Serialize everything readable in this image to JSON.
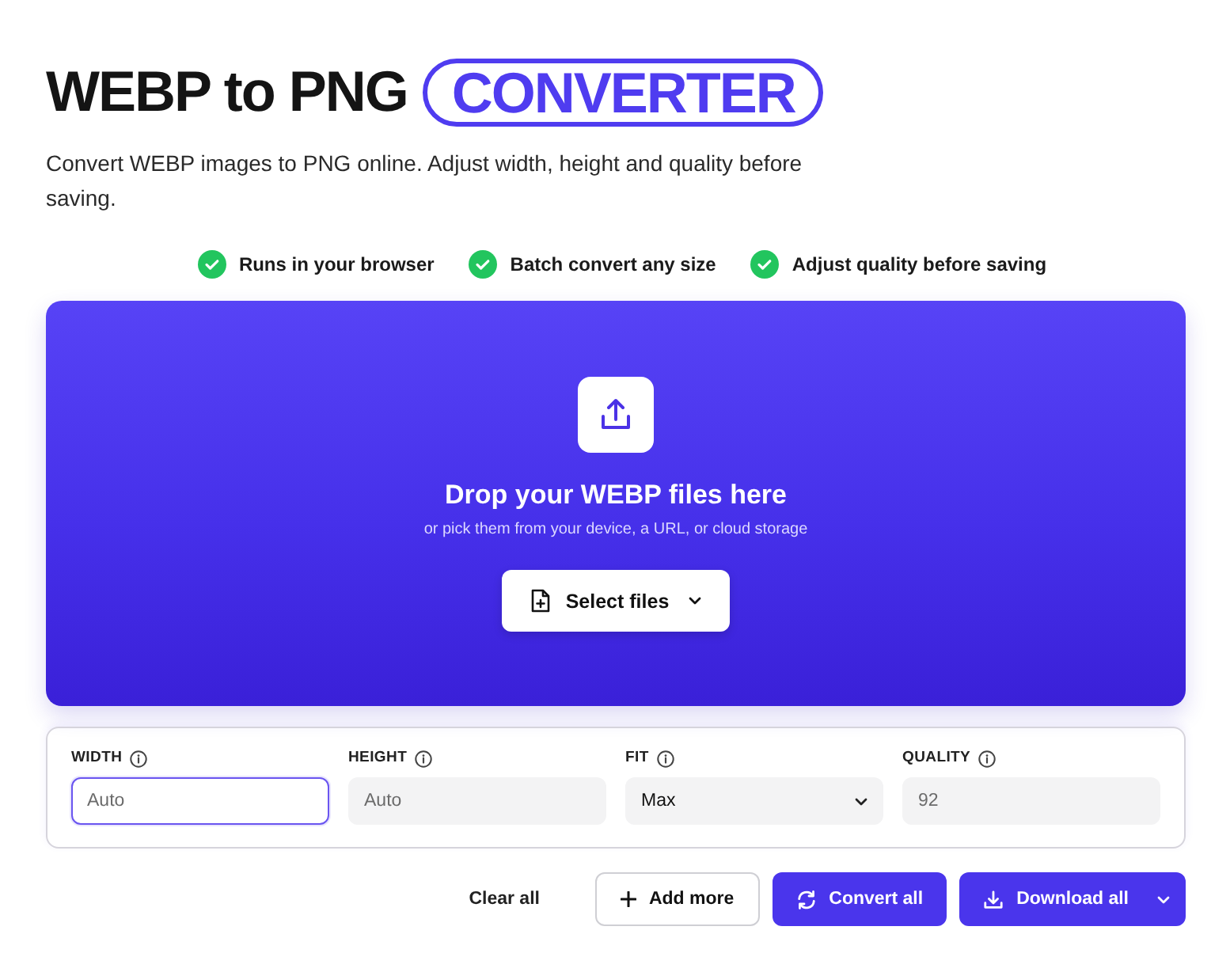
{
  "header": {
    "title": "WEBP to PNG",
    "title_badge": "CONVERTER",
    "description": "Convert WEBP images to PNG online. Adjust width, height and quality before saving."
  },
  "features": [
    {
      "label": "Runs in your browser"
    },
    {
      "label": "Batch convert any size"
    },
    {
      "label": "Adjust quality before saving"
    }
  ],
  "dropzone": {
    "heading": "Drop your WEBP files here",
    "subtext": "or pick them from your device, a URL, or cloud storage",
    "select_button": "Select files"
  },
  "settings": [
    {
      "kind": "input",
      "label": "WIDTH",
      "placeholder": "Auto",
      "focused": true
    },
    {
      "kind": "input",
      "label": "HEIGHT",
      "placeholder": "Auto",
      "focused": false
    },
    {
      "kind": "select",
      "label": "FIT",
      "value": "Max",
      "focused": false
    },
    {
      "kind": "input",
      "label": "QUALITY",
      "placeholder": "92",
      "focused": false
    }
  ],
  "actions": [
    {
      "kind": "text",
      "label": "Clear all"
    },
    {
      "kind": "outline",
      "label": "Add more"
    },
    {
      "kind": "primary",
      "label": "Convert all"
    },
    {
      "kind": "split",
      "label": "Download all"
    }
  ]
}
